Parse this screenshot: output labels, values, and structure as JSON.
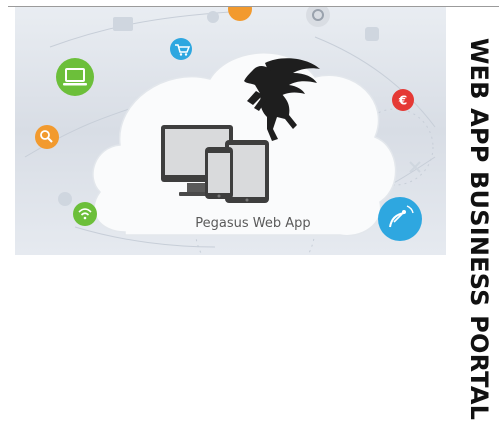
{
  "sidebar": {
    "title": "WEB APP BUSINESS PORTAL"
  },
  "hero": {
    "caption": "Pegasus Web App",
    "logo": "pegasus-icon",
    "icons": [
      "envelope-icon",
      "shopping-cart-icon",
      "laptop-icon",
      "search-icon",
      "wifi-icon",
      "euro-icon",
      "satellite-dish-icon",
      "gear-icon",
      "desktop-monitor-icon",
      "tablet-icon",
      "phone-icon"
    ]
  },
  "colors": {
    "green": "#6cbf3a",
    "orange": "#f29a2e",
    "red": "#e53935",
    "blue": "#2ea7e0",
    "cloud": "#f8f9fb",
    "device_dark": "#4a4a4a",
    "side_title": "#111111"
  }
}
